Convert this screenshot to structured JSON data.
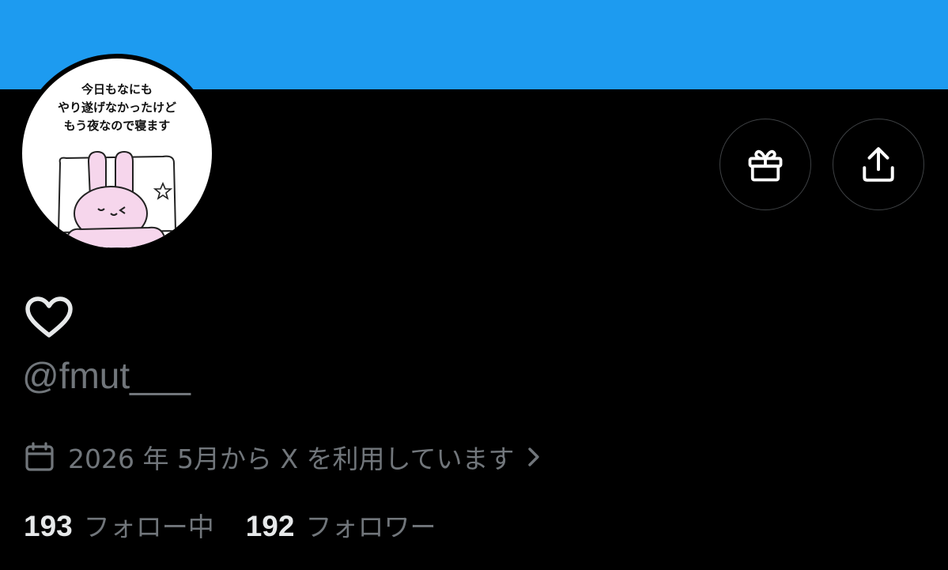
{
  "profile": {
    "avatar_caption_lines": [
      "今日もなにも",
      "やり遂げなかったけど",
      "もう夜なので寝ます"
    ],
    "handle": "@fmut___",
    "joined": "2026 年 5月から X を利用しています",
    "following_count": "193",
    "following_label": "フォロー中",
    "followers_count": "192",
    "followers_label": "フォロワー"
  },
  "icons": {
    "gift": "gift-icon",
    "share": "share-icon",
    "heart": "heart-icon",
    "calendar": "calendar-icon",
    "chevron": "chevron-right-icon"
  },
  "colors": {
    "banner": "#1d9bf0",
    "background": "#000000",
    "primary_text": "#e7e9ea",
    "secondary_text": "#71767b",
    "button_border": "#3e4144"
  }
}
